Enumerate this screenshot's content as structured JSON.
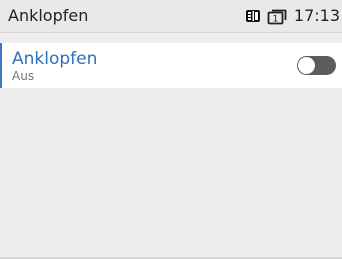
{
  "header": {
    "title": "Anklopfen",
    "time": "17:13",
    "line_number": "1",
    "icons": [
      "phonebook-icon",
      "line-1-icon"
    ]
  },
  "setting": {
    "title": "Anklopfen",
    "value": "Aus",
    "toggle_state": "off"
  },
  "colors": {
    "accent": "#3d78c0",
    "header_background": "#e9e9e9",
    "screen_background": "#eeeeee",
    "toggle_off": "#5c5c5c"
  }
}
